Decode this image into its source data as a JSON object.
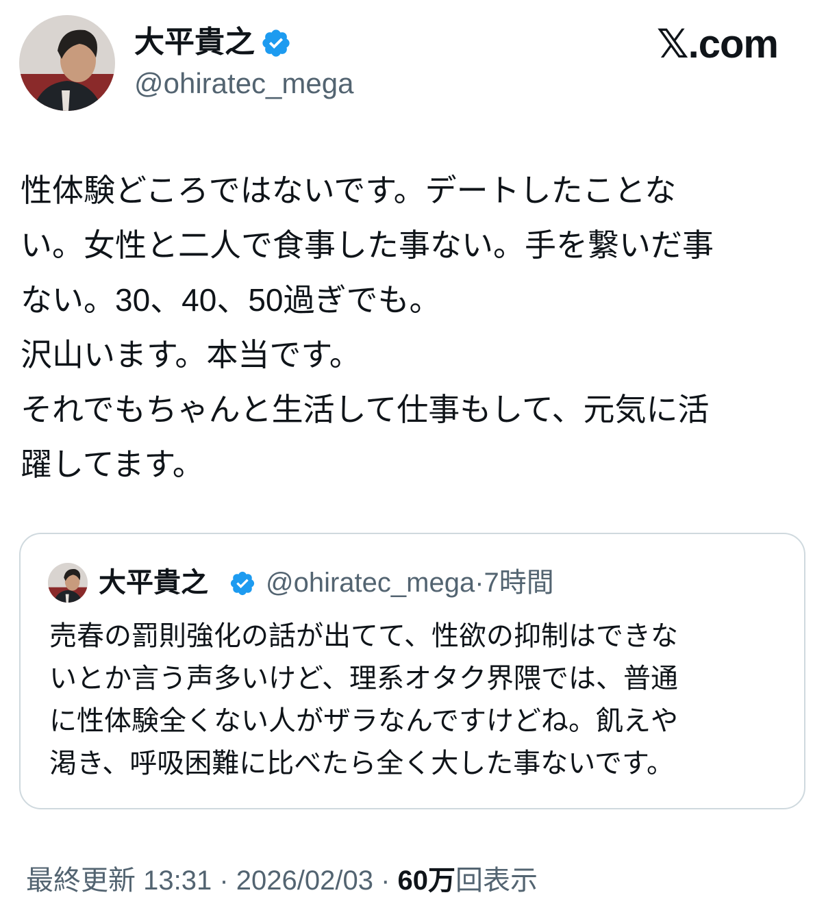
{
  "author": {
    "display_name": "大平貴之",
    "handle": "@ohiratec_mega",
    "verified": true,
    "avatar_icon": "user-avatar-photo"
  },
  "brand": {
    "logo_text": "𝕏.com"
  },
  "tweet": {
    "lines": [
      "性体験どころではないです。デートしたことな",
      "い。女性と二人で食事した事ない。手を繋いだ事",
      "ない。30、40、50過ぎでも。",
      "沢山います。本当です。",
      "それでもちゃんと生活して仕事もして、元気に活",
      "躍してます。"
    ]
  },
  "quote": {
    "display_name": "大平貴之",
    "handle": "@ohiratec_mega",
    "separator": "·",
    "time": "7時間",
    "lines": [
      "売春の罰則強化の話が出てて、性欲の抑制はできな",
      "いとか言う声多いけど、理系オタク界隈では、普通",
      "に性体験全くない人がザラなんですけどね。飢えや",
      "渇き、呼吸困難に比べたら全く大した事ないです。"
    ]
  },
  "footer": {
    "updated_label": "最終更新 13:31 · 2026/02/03",
    "separator": " · ",
    "views_count": "60万",
    "views_label": "回表示"
  },
  "colors": {
    "verified_blue": "#1d9bf0",
    "secondary_text": "#536471",
    "border": "#cfd9de"
  }
}
